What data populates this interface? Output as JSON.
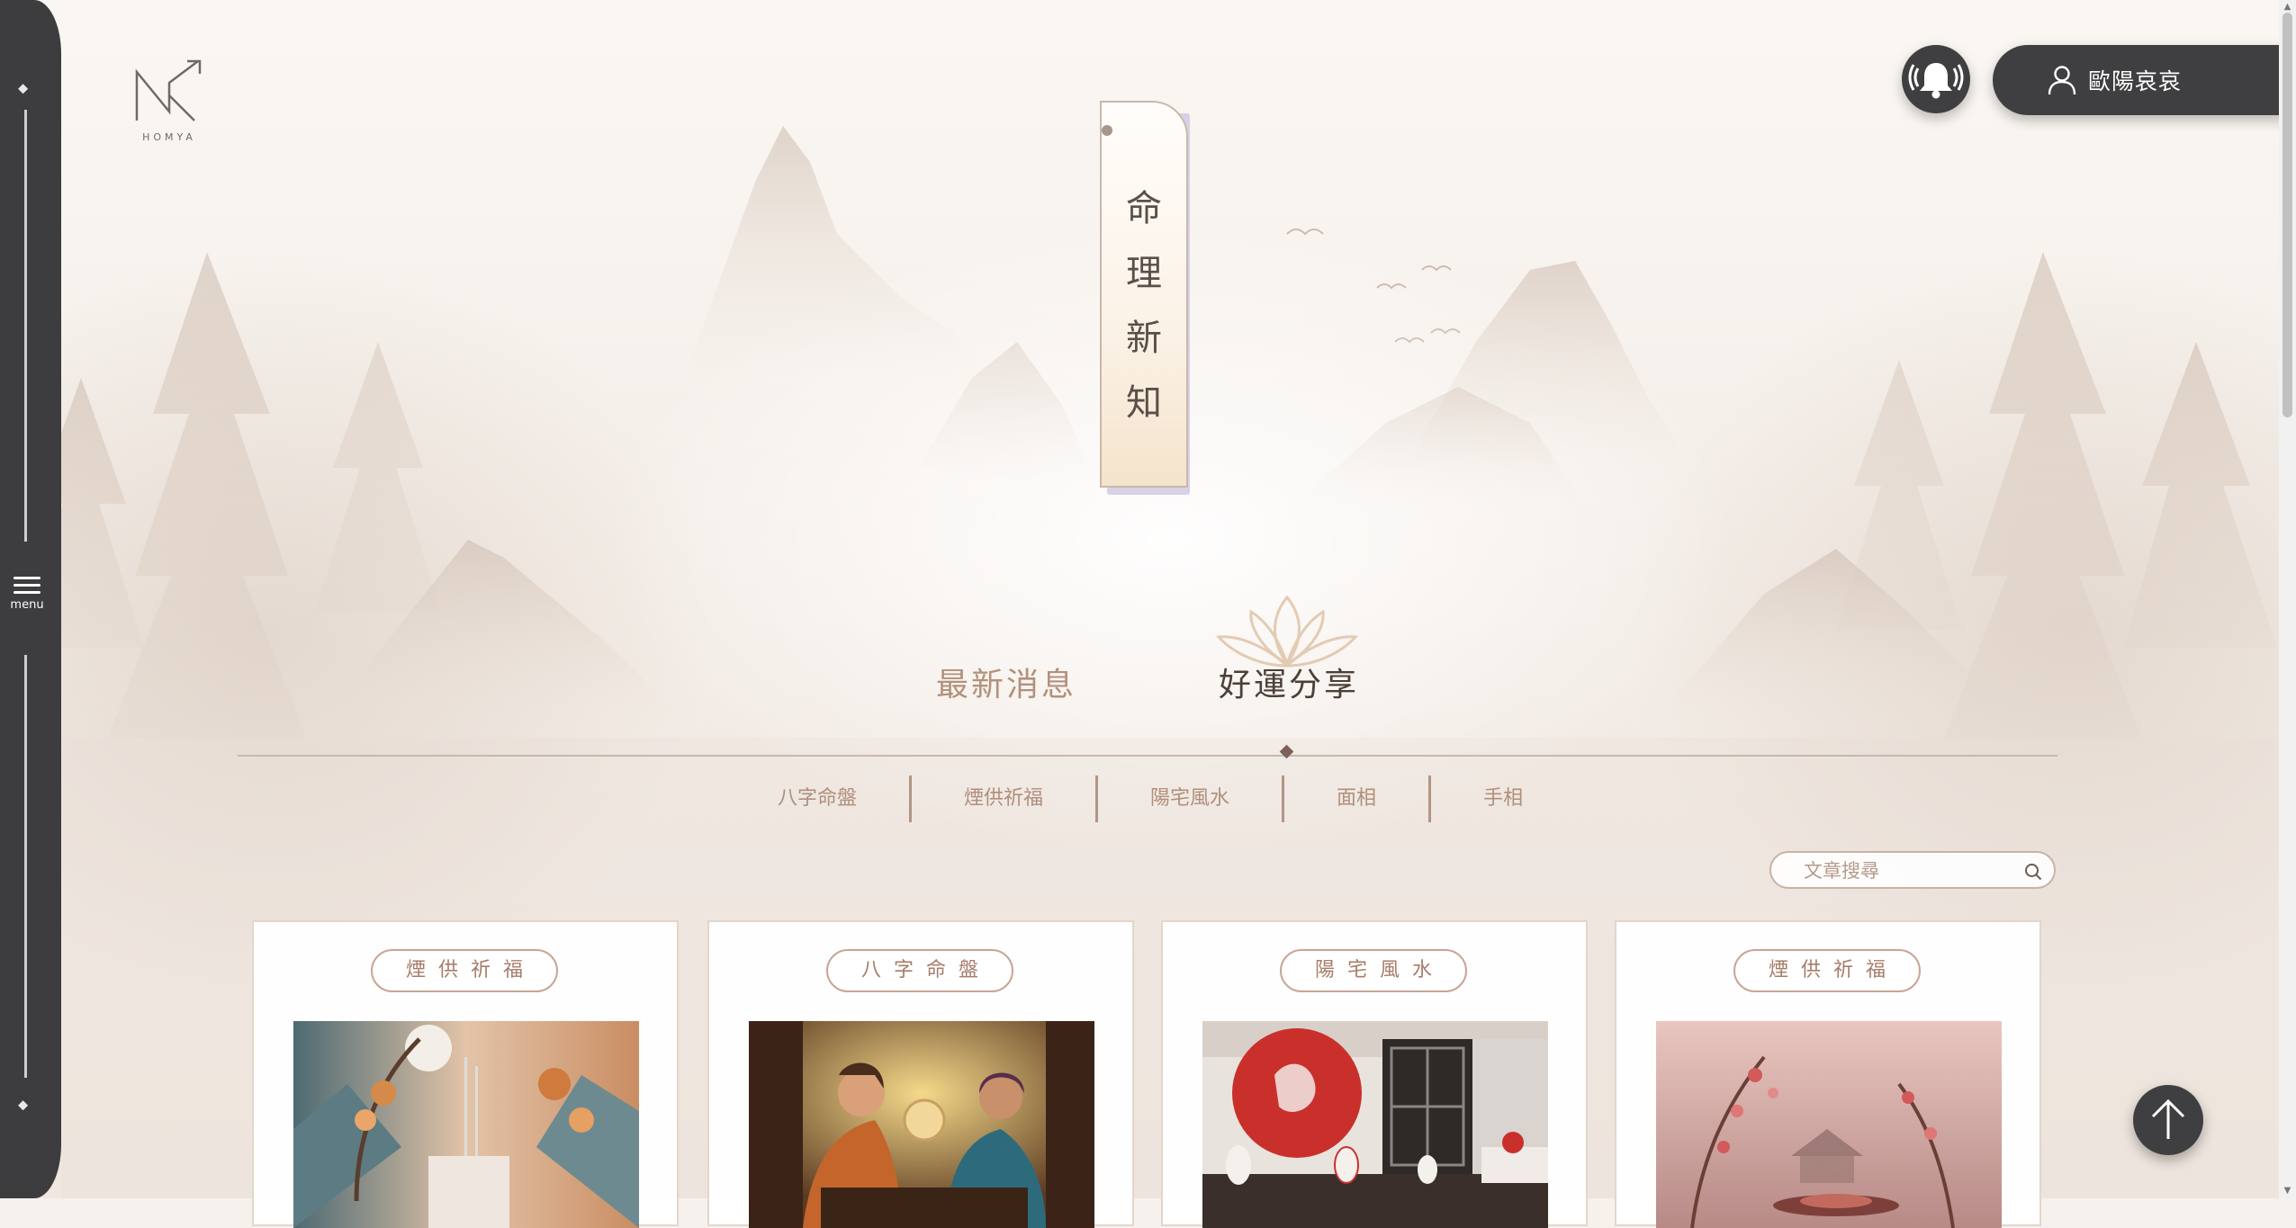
{
  "logo": {
    "text": "HOMYA"
  },
  "sidebar": {
    "menu_label": "menu"
  },
  "header": {
    "user_name": "歐陽哀哀"
  },
  "banner": {
    "title_chars": [
      "命",
      "理",
      "新",
      "知"
    ]
  },
  "tabs": {
    "latest": "最新消息",
    "share": "好運分享"
  },
  "categories": [
    "八字命盤",
    "煙供祈福",
    "陽宅風水",
    "面相",
    "手相"
  ],
  "search": {
    "placeholder": "文章搜尋"
  },
  "cards": [
    {
      "tag": "煙供祈福"
    },
    {
      "tag": "八字命盤"
    },
    {
      "tag": "陽宅風水"
    },
    {
      "tag": "煙供祈福"
    }
  ],
  "colors": {
    "dark": "#3d3d3f",
    "accent": "#b08f7c",
    "title": "#4b3f38"
  }
}
